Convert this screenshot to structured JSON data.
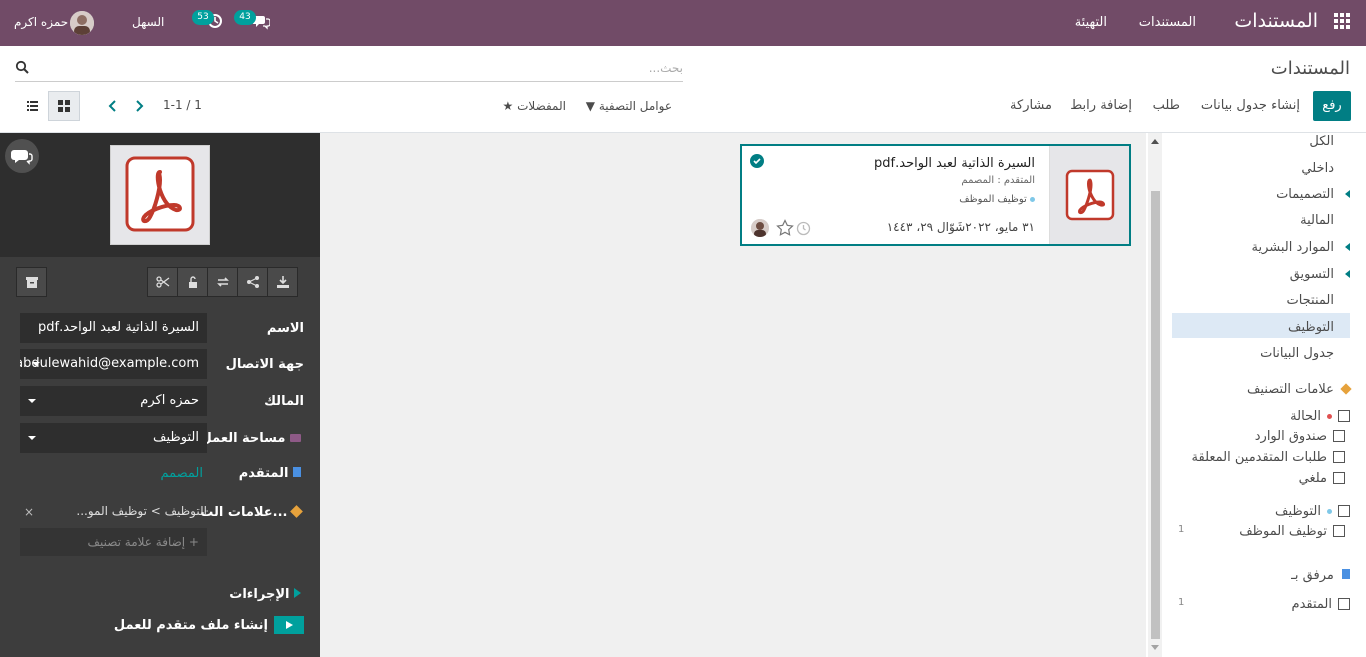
{
  "navbar": {
    "brand": "المستندات",
    "menu": [
      "المستندات",
      "التهيئة"
    ],
    "user_name": "حمزه اكرم",
    "company": "السهل",
    "messages_count": "43",
    "activities_count": "53",
    "colors": {
      "bar": "#714b67",
      "badge": "#00a09d"
    },
    "icons": [
      "apps-grid-icon",
      "messages-icon",
      "activity-clock-icon"
    ]
  },
  "control_panel": {
    "title": "المستندات",
    "search_placeholder": "بحث...",
    "upload": "رفع",
    "buttons": [
      "إنشاء جدول بيانات",
      "طلب",
      "إضافة رابط",
      "مشاركة"
    ],
    "filters": "عوامل التصفية",
    "favorites": "المفضلات",
    "pager": "1-1 / 1",
    "views": [
      "kanban",
      "list"
    ],
    "active_view": "kanban",
    "accent": "#017e84"
  },
  "inspector": {
    "fields": {
      "name_label": "الاسم",
      "name_value": "السيرة الذاتية لعبد الواحد.pdf",
      "contact_label": "جهة الاتصال",
      "contact_value": "abdulewahid@example.com",
      "owner_label": "المالك",
      "owner_value": "حمزه اكرم",
      "workspace_label": "مساحة العمل",
      "workspace_value": "التوظيف",
      "applicant_label": "المتقدم",
      "applicant_value": "المصمم",
      "tags_label": "علامات الت...",
      "tag_value": "التوظيف > توظيف المو...",
      "add_tag_placeholder": "+ إضافة علامة تصنيف"
    },
    "actions_title": "الإجراءات",
    "action_label": "إنشاء ملف متقدم للعمل",
    "tool_icons": [
      "download-icon",
      "share-icon",
      "replace-icon",
      "lock-icon",
      "split-icon"
    ]
  },
  "card": {
    "title": "السيرة الذاتية لعبد الواحد.pdf",
    "subtitle": "المتقدم : المصمم",
    "tag": "توظيف الموظف",
    "date": "٣١ مايو، ٢٠٢٢شَوّال ٢٩، ١٤٤٣",
    "file_type": "pdf"
  },
  "sidebar": {
    "folders": [
      {
        "label": "الكل",
        "caret": false
      },
      {
        "label": "داخلي",
        "caret": false
      },
      {
        "label": "التصميمات",
        "caret": true
      },
      {
        "label": "المالية",
        "caret": false
      },
      {
        "label": "الموارد البشرية",
        "caret": true
      },
      {
        "label": "التسويق",
        "caret": true
      },
      {
        "label": "المنتجات",
        "caret": false
      },
      {
        "label": "التوظيف",
        "caret": false,
        "active": true
      },
      {
        "label": "جدول البيانات",
        "caret": false
      }
    ],
    "tags_title": "علامات التصنيف",
    "status_group": "الحالة",
    "status_items": [
      "صندوق الوارد",
      "طلبات المتقدمين المعلقة",
      "ملغي"
    ],
    "recruit_group": "التوظيف",
    "recruit_items": [
      {
        "label": "توظيف الموظف",
        "count": "1"
      }
    ],
    "attached_title": "مرفق بـ",
    "attached_items": [
      {
        "label": "المتقدم",
        "count": "1"
      }
    ]
  }
}
